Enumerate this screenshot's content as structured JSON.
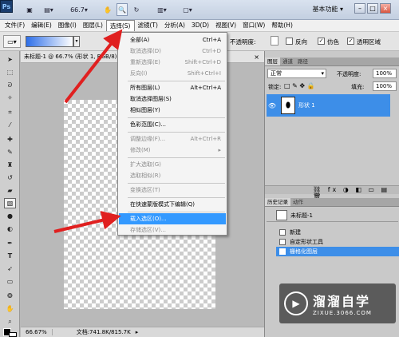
{
  "app": {
    "logo": "Ps",
    "zoom": "66.7",
    "workspace": "基本功能"
  },
  "window_buttons": [
    "–",
    "□",
    "×"
  ],
  "menubar": [
    "文件(F)",
    "编辑(E)",
    "图像(I)",
    "图层(L)",
    "选择(S)",
    "滤镜(T)",
    "分析(A)",
    "3D(D)",
    "视图(V)",
    "窗口(W)",
    "帮助(H)"
  ],
  "options": {
    "opacity_label": "不透明度:",
    "reverse": "反向",
    "dither": "仿色",
    "transparent_region": "透明区域"
  },
  "document": {
    "tab_title": "未标题-1 @ 66.7% (形状 1, RGB/8)",
    "status_zoom": "66.67%",
    "status_doc": "文档:741.8K/815.7K"
  },
  "select_menu": [
    {
      "label": "全部(A)",
      "shortcut": "Ctrl+A",
      "enabled": true
    },
    {
      "label": "取消选择(D)",
      "shortcut": "Ctrl+D",
      "enabled": false
    },
    {
      "label": "重新选择(E)",
      "shortcut": "Shift+Ctrl+D",
      "enabled": false
    },
    {
      "label": "反向(I)",
      "shortcut": "Shift+Ctrl+I",
      "enabled": false
    },
    {
      "label": "所有图层(L)",
      "shortcut": "Alt+Ctrl+A",
      "enabled": true
    },
    {
      "label": "取消选择图层(S)",
      "shortcut": "",
      "enabled": true
    },
    {
      "label": "相似图层(Y)",
      "shortcut": "",
      "enabled": true
    },
    {
      "label": "色彩范围(C)...",
      "shortcut": "",
      "enabled": true
    },
    {
      "label": "调整边缘(F)...",
      "shortcut": "Alt+Ctrl+R",
      "enabled": false
    },
    {
      "label": "修改(M)",
      "shortcut": "▸",
      "enabled": false
    },
    {
      "label": "扩大选取(G)",
      "shortcut": "",
      "enabled": false
    },
    {
      "label": "选取相似(R)",
      "shortcut": "",
      "enabled": false
    },
    {
      "label": "变换选区(T)",
      "shortcut": "",
      "enabled": false
    },
    {
      "label": "在快速蒙版模式下编辑(Q)",
      "shortcut": "",
      "enabled": true
    },
    {
      "label": "载入选区(O)...",
      "shortcut": "",
      "enabled": true,
      "highlighted": true
    },
    {
      "label": "存储选区(V)...",
      "shortcut": "",
      "enabled": false
    }
  ],
  "layers_panel": {
    "tabs": [
      "图层",
      "通道",
      "路径"
    ],
    "blend_mode": "正常",
    "opacity_label": "不透明度:",
    "lock_label": "锁定:",
    "fill_label": "填充:",
    "opacity_value": "100%",
    "fill_value": "100%",
    "layer_name": "形状 1"
  },
  "history_panel": {
    "tabs": [
      "历史记录",
      "动作"
    ],
    "snapshot": "未标题-1",
    "items": [
      "新建",
      "自定形状工具",
      "栅格化图层"
    ]
  },
  "watermark": {
    "title": "溜溜自学",
    "url": "ZIXUE.3066.COM"
  }
}
